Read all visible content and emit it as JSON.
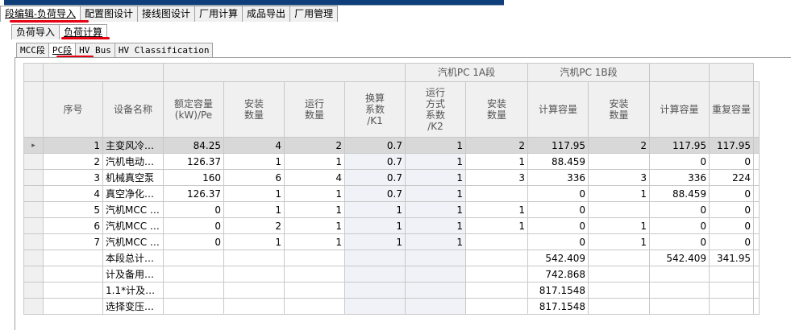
{
  "main_tabs": [
    "段编辑-负荷导入",
    "配置图设计",
    "接线图设计",
    "厂用计算",
    "成品导出",
    "厂用管理"
  ],
  "sub_tabs": [
    "负荷导入",
    "负荷计算"
  ],
  "segment_tabs": [
    "MCC段",
    "PC段",
    "HV Bus",
    "HV Classification"
  ],
  "grid": {
    "group_headers": [
      "汽机PC 1A段",
      "汽机PC 1B段"
    ],
    "columns": [
      "序号",
      "设备名称",
      "额定容量\n(kW)/Pe",
      "安装\n数量",
      "运行\n数量",
      "换算\n系数\n/K1",
      "运行\n方式\n系数\n/K2",
      "安装\n数量",
      "计算容量",
      "安装\n数量",
      "计算容量",
      "重复容量"
    ],
    "rows": [
      {
        "marker": "▸",
        "cells": [
          "1",
          "主变风冷…",
          "84.25",
          "4",
          "2",
          "0.7",
          "1",
          "2",
          "117.95",
          "2",
          "117.95",
          "117.95"
        ]
      },
      {
        "marker": "",
        "cells": [
          "2",
          "汽机电动…",
          "126.37",
          "1",
          "1",
          "0.7",
          "1",
          "1",
          "88.459",
          "",
          "0",
          "0"
        ]
      },
      {
        "marker": "",
        "cells": [
          "3",
          "机械真空泵",
          "160",
          "6",
          "4",
          "0.7",
          "1",
          "3",
          "336",
          "3",
          "336",
          "224"
        ]
      },
      {
        "marker": "",
        "cells": [
          "4",
          "真空净化…",
          "126.37",
          "1",
          "1",
          "0.7",
          "1",
          "",
          "0",
          "1",
          "88.459",
          "0"
        ]
      },
      {
        "marker": "",
        "cells": [
          "5",
          "汽机MCC …",
          "0",
          "1",
          "1",
          "1",
          "1",
          "1",
          "0",
          "",
          "0",
          "0"
        ]
      },
      {
        "marker": "",
        "cells": [
          "6",
          "汽机MCC …",
          "0",
          "2",
          "1",
          "1",
          "1",
          "1",
          "0",
          "1",
          "0",
          "0"
        ]
      },
      {
        "marker": "",
        "cells": [
          "7",
          "汽机MCC …",
          "0",
          "1",
          "1",
          "1",
          "1",
          "",
          "0",
          "1",
          "0",
          "0"
        ]
      },
      {
        "marker": "",
        "cells": [
          "",
          "本段总计…",
          "",
          "",
          "",
          "",
          "",
          "",
          "542.409",
          "",
          "542.409",
          "341.95"
        ]
      },
      {
        "marker": "",
        "cells": [
          "",
          "计及备用…",
          "",
          "",
          "",
          "",
          "",
          "",
          "742.868",
          "",
          "",
          ""
        ]
      },
      {
        "marker": "",
        "cells": [
          "",
          "1.1*计及…",
          "",
          "",
          "",
          "",
          "",
          "",
          "817.1548",
          "",
          "",
          ""
        ]
      },
      {
        "marker": "",
        "cells": [
          "",
          "选择变压…",
          "",
          "",
          "",
          "",
          "",
          "",
          "817.1548",
          "",
          "",
          ""
        ]
      }
    ]
  },
  "colors": {
    "highlight_red": "#e60012",
    "selected_row": "#d8d8d8",
    "header_bg": "#f0f0f0"
  }
}
